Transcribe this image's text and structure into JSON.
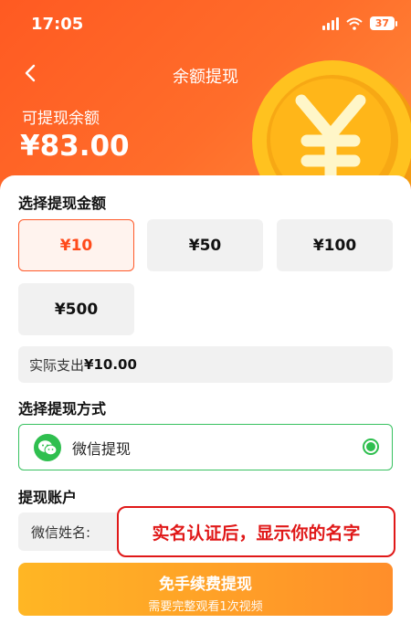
{
  "status_bar": {
    "time": "17:05",
    "battery": "37"
  },
  "header": {
    "title": "余额提现",
    "balance_label": "可提现余额",
    "balance_value": "¥83.00"
  },
  "amount_section": {
    "title": "选择提现金额",
    "options": [
      {
        "label": "¥10",
        "selected": true
      },
      {
        "label": "¥50",
        "selected": false
      },
      {
        "label": "¥100",
        "selected": false
      },
      {
        "label": "¥500",
        "selected": false
      }
    ],
    "actual_prefix": "实际支出",
    "actual_amount": "¥10.00"
  },
  "method_section": {
    "title": "选择提现方式",
    "option_label": "微信提现"
  },
  "account_section": {
    "title": "提现账户",
    "name_label": "微信姓名:",
    "overlay_note": "实名认证后，显示你的名字"
  },
  "submit": {
    "label": "免手续费提现",
    "sublabel": "需要完整观看1次视频"
  },
  "colors": {
    "accent": "#ff5a22",
    "wechat_green": "#2fbf4f",
    "button_gradient_start": "#ffb624",
    "button_gradient_end": "#ff8e2a",
    "note_red": "#e01818"
  }
}
